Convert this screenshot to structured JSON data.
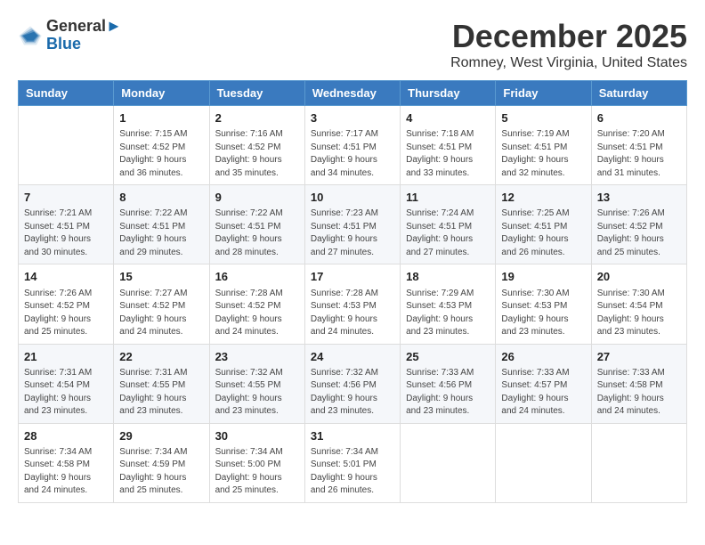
{
  "header": {
    "logo_general": "General",
    "logo_blue": "Blue",
    "main_title": "December 2025",
    "subtitle": "Romney, West Virginia, United States"
  },
  "calendar": {
    "days_of_week": [
      "Sunday",
      "Monday",
      "Tuesday",
      "Wednesday",
      "Thursday",
      "Friday",
      "Saturday"
    ],
    "weeks": [
      [
        {
          "day": "",
          "info": ""
        },
        {
          "day": "1",
          "info": "Sunrise: 7:15 AM\nSunset: 4:52 PM\nDaylight: 9 hours\nand 36 minutes."
        },
        {
          "day": "2",
          "info": "Sunrise: 7:16 AM\nSunset: 4:52 PM\nDaylight: 9 hours\nand 35 minutes."
        },
        {
          "day": "3",
          "info": "Sunrise: 7:17 AM\nSunset: 4:51 PM\nDaylight: 9 hours\nand 34 minutes."
        },
        {
          "day": "4",
          "info": "Sunrise: 7:18 AM\nSunset: 4:51 PM\nDaylight: 9 hours\nand 33 minutes."
        },
        {
          "day": "5",
          "info": "Sunrise: 7:19 AM\nSunset: 4:51 PM\nDaylight: 9 hours\nand 32 minutes."
        },
        {
          "day": "6",
          "info": "Sunrise: 7:20 AM\nSunset: 4:51 PM\nDaylight: 9 hours\nand 31 minutes."
        }
      ],
      [
        {
          "day": "7",
          "info": "Sunrise: 7:21 AM\nSunset: 4:51 PM\nDaylight: 9 hours\nand 30 minutes."
        },
        {
          "day": "8",
          "info": "Sunrise: 7:22 AM\nSunset: 4:51 PM\nDaylight: 9 hours\nand 29 minutes."
        },
        {
          "day": "9",
          "info": "Sunrise: 7:22 AM\nSunset: 4:51 PM\nDaylight: 9 hours\nand 28 minutes."
        },
        {
          "day": "10",
          "info": "Sunrise: 7:23 AM\nSunset: 4:51 PM\nDaylight: 9 hours\nand 27 minutes."
        },
        {
          "day": "11",
          "info": "Sunrise: 7:24 AM\nSunset: 4:51 PM\nDaylight: 9 hours\nand 27 minutes."
        },
        {
          "day": "12",
          "info": "Sunrise: 7:25 AM\nSunset: 4:51 PM\nDaylight: 9 hours\nand 26 minutes."
        },
        {
          "day": "13",
          "info": "Sunrise: 7:26 AM\nSunset: 4:52 PM\nDaylight: 9 hours\nand 25 minutes."
        }
      ],
      [
        {
          "day": "14",
          "info": "Sunrise: 7:26 AM\nSunset: 4:52 PM\nDaylight: 9 hours\nand 25 minutes."
        },
        {
          "day": "15",
          "info": "Sunrise: 7:27 AM\nSunset: 4:52 PM\nDaylight: 9 hours\nand 24 minutes."
        },
        {
          "day": "16",
          "info": "Sunrise: 7:28 AM\nSunset: 4:52 PM\nDaylight: 9 hours\nand 24 minutes."
        },
        {
          "day": "17",
          "info": "Sunrise: 7:28 AM\nSunset: 4:53 PM\nDaylight: 9 hours\nand 24 minutes."
        },
        {
          "day": "18",
          "info": "Sunrise: 7:29 AM\nSunset: 4:53 PM\nDaylight: 9 hours\nand 23 minutes."
        },
        {
          "day": "19",
          "info": "Sunrise: 7:30 AM\nSunset: 4:53 PM\nDaylight: 9 hours\nand 23 minutes."
        },
        {
          "day": "20",
          "info": "Sunrise: 7:30 AM\nSunset: 4:54 PM\nDaylight: 9 hours\nand 23 minutes."
        }
      ],
      [
        {
          "day": "21",
          "info": "Sunrise: 7:31 AM\nSunset: 4:54 PM\nDaylight: 9 hours\nand 23 minutes."
        },
        {
          "day": "22",
          "info": "Sunrise: 7:31 AM\nSunset: 4:55 PM\nDaylight: 9 hours\nand 23 minutes."
        },
        {
          "day": "23",
          "info": "Sunrise: 7:32 AM\nSunset: 4:55 PM\nDaylight: 9 hours\nand 23 minutes."
        },
        {
          "day": "24",
          "info": "Sunrise: 7:32 AM\nSunset: 4:56 PM\nDaylight: 9 hours\nand 23 minutes."
        },
        {
          "day": "25",
          "info": "Sunrise: 7:33 AM\nSunset: 4:56 PM\nDaylight: 9 hours\nand 23 minutes."
        },
        {
          "day": "26",
          "info": "Sunrise: 7:33 AM\nSunset: 4:57 PM\nDaylight: 9 hours\nand 24 minutes."
        },
        {
          "day": "27",
          "info": "Sunrise: 7:33 AM\nSunset: 4:58 PM\nDaylight: 9 hours\nand 24 minutes."
        }
      ],
      [
        {
          "day": "28",
          "info": "Sunrise: 7:34 AM\nSunset: 4:58 PM\nDaylight: 9 hours\nand 24 minutes."
        },
        {
          "day": "29",
          "info": "Sunrise: 7:34 AM\nSunset: 4:59 PM\nDaylight: 9 hours\nand 25 minutes."
        },
        {
          "day": "30",
          "info": "Sunrise: 7:34 AM\nSunset: 5:00 PM\nDaylight: 9 hours\nand 25 minutes."
        },
        {
          "day": "31",
          "info": "Sunrise: 7:34 AM\nSunset: 5:01 PM\nDaylight: 9 hours\nand 26 minutes."
        },
        {
          "day": "",
          "info": ""
        },
        {
          "day": "",
          "info": ""
        },
        {
          "day": "",
          "info": ""
        }
      ]
    ]
  }
}
